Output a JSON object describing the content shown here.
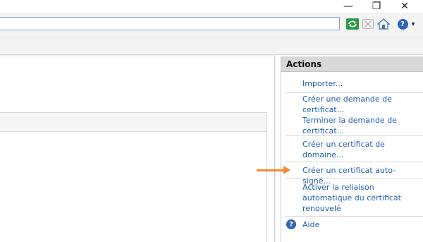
{
  "window": {
    "minimize_glyph": "—",
    "restore_glyph": "❐",
    "close_glyph": "✕"
  },
  "toolbar": {
    "help_dropdown_glyph": "▾",
    "help_glyph": "?"
  },
  "actions": {
    "title": "Actions",
    "items": [
      {
        "lines": [
          "Importer..."
        ]
      },
      {
        "lines": [
          "Créer une demande de",
          "certificat..."
        ]
      },
      {
        "lines": [
          "Terminer la demande de",
          "certificat..."
        ]
      },
      {
        "lines": [
          "Créer un certificat de",
          "domaine..."
        ]
      },
      {
        "lines": [
          "Créer un certificat auto-signé..."
        ]
      },
      {
        "lines": [
          "Activer la reliaison",
          "automatique du certificat",
          "renouvelé"
        ]
      },
      {
        "lines": [
          "Aide"
        ]
      }
    ]
  },
  "colors": {
    "link": "#1f5fb0",
    "arrow": "#f28a2e",
    "address_border": "#7aa7d6"
  }
}
